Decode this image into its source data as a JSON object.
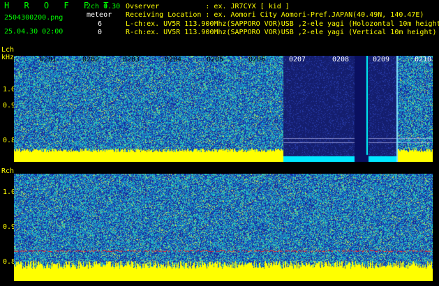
{
  "header": {
    "logo": "H R O F F T",
    "channel_info": "2ch 0.30",
    "filename": "2504300200.png",
    "datetime": "25.04.30 02:00",
    "meteor_label": "meteor",
    "meteor_lch": "6",
    "meteor_rch": "0",
    "observer": "Ovserver           : ex. JR7CYX [ kid ]",
    "location": "Receiving Location : ex. Aomori City Aomori-Pref.JAPAN(40.49N, 140.47E)",
    "lch_desc": "L-ch:ex. UV5R 113.900Mhz(SAPPORO VOR)USB ,2-ele yagi (Holozontal 10m height",
    "rch_desc": "R-ch:ex. UV5R 113.900Mhz(SAPPORO VOR)USB ,2-ele yagi (Vertical 10m height)"
  },
  "lch": {
    "label": "Lch",
    "unit": "kHz",
    "ticks": [
      "1.0",
      "0.9",
      "0.8"
    ],
    "time_labels": [
      "0201",
      "0202",
      "0203",
      "0204",
      "0205",
      "0206",
      "0207",
      "0208",
      "0209",
      "0210"
    ]
  },
  "rch": {
    "label": "Rch",
    "ticks": [
      "1.0",
      "0.9",
      "0.8"
    ]
  },
  "colors": {
    "background": "#000000",
    "label_yellow": "#ffff00",
    "logo_green": "#00ff00",
    "noise_blue": "#1a2fa0",
    "noise_cyan": "#18c8d0",
    "signal_yellow": "#ffff00",
    "baseline_cyan": "#00e8ff",
    "carrier_red": "#ff2020"
  }
}
